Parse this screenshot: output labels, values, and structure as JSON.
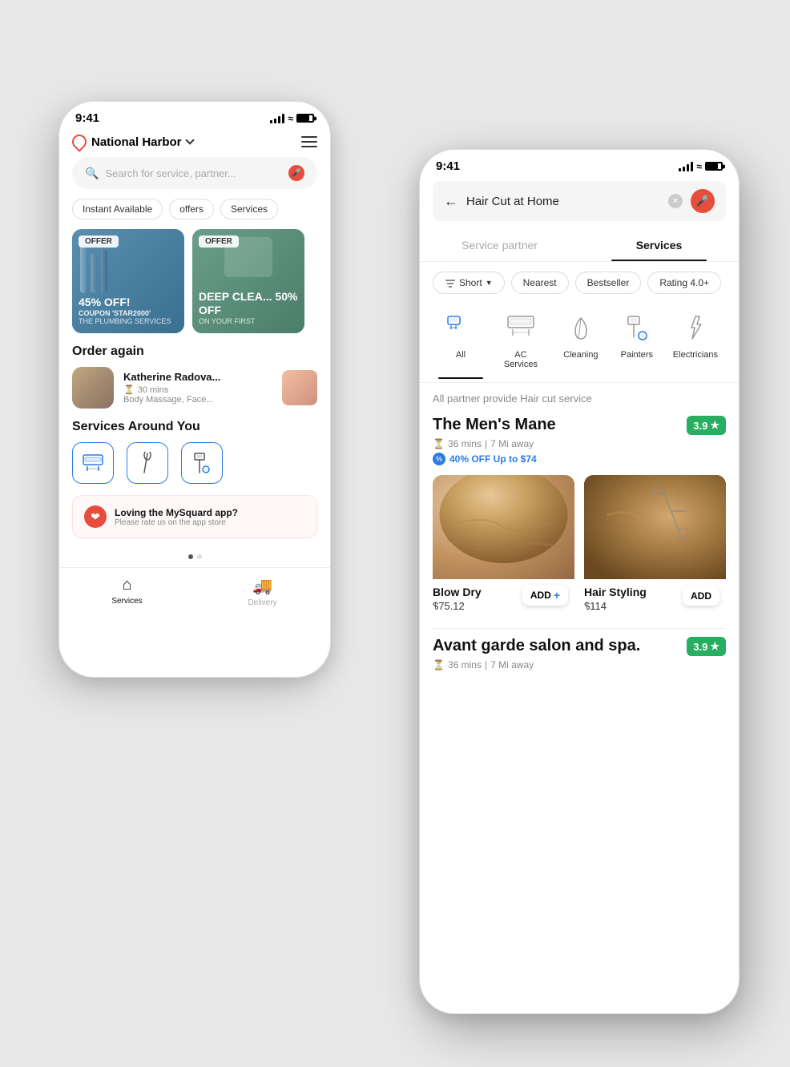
{
  "scene": {
    "background": "#e8e8e8"
  },
  "phone_back": {
    "status": {
      "time": "9:41"
    },
    "location": "National Harbor",
    "hamburger_label": "menu",
    "search_placeholder": "Search for service, partner...",
    "filters": [
      {
        "label": "Instant Available"
      },
      {
        "label": "offers"
      },
      {
        "label": "Services"
      }
    ],
    "offers": [
      {
        "badge": "OFFER",
        "discount": "45% OFF!",
        "coupon": "COUPON 'STAR2000'",
        "service": "THE PLUMBING SERVICES"
      },
      {
        "badge": "OFFER",
        "discount": "DEEP CLEA... 50% OFF",
        "coupon": "",
        "service": "ON YOUR FIRST"
      }
    ],
    "order_again": {
      "title": "Order again",
      "items": [
        {
          "name": "Katherine Radova...",
          "time": "30 mins",
          "services": "Body Massage, Face..."
        }
      ]
    },
    "services_around": {
      "title": "Services Around You",
      "items": [
        {
          "label": "AC",
          "icon": "ac-icon"
        },
        {
          "label": "Cleaning",
          "icon": "cleaning-icon"
        },
        {
          "label": "Painters",
          "icon": "painters-icon"
        }
      ]
    },
    "rate_app": {
      "title": "Loving the MySquard app?",
      "subtitle": "Please rate us on the app store"
    },
    "bottom_tabs": [
      {
        "label": "Services",
        "icon": "home",
        "active": true
      },
      {
        "label": "Delivery",
        "icon": "delivery",
        "active": false
      }
    ]
  },
  "phone_front": {
    "status": {
      "time": "9:41"
    },
    "search_value": "Hair Cut at Home",
    "tabs": [
      {
        "label": "Service partner",
        "active": false
      },
      {
        "label": "Services",
        "active": true
      }
    ],
    "filters": [
      {
        "label": "Short",
        "has_dropdown": true
      },
      {
        "label": "Nearest"
      },
      {
        "label": "Bestseller"
      },
      {
        "label": "Rating 4.0+"
      }
    ],
    "categories": [
      {
        "label": "All",
        "active": true,
        "icon": "all-icon"
      },
      {
        "label": "AC Services",
        "active": false,
        "icon": "ac-icon"
      },
      {
        "label": "Cleaning",
        "active": false,
        "icon": "cleaning-icon"
      },
      {
        "label": "Painters",
        "active": false,
        "icon": "painters-icon"
      },
      {
        "label": "Electricians",
        "active": false,
        "icon": "electricians-icon"
      }
    ],
    "section_title": "All partner provide Hair cut service",
    "partners": [
      {
        "name": "The Men's Mane",
        "rating": "3.9",
        "time": "36 mins",
        "distance": "7 Mi away",
        "discount": "40% OFF Up to $74",
        "services": [
          {
            "name": "Blow Dry",
            "price": "$75.12"
          },
          {
            "name": "Hair Styling",
            "price": "$114"
          }
        ]
      },
      {
        "name": "Avant garde salon and spa.",
        "rating": "3.9",
        "time": "36 mins",
        "distance": "7 Mi away"
      }
    ]
  }
}
